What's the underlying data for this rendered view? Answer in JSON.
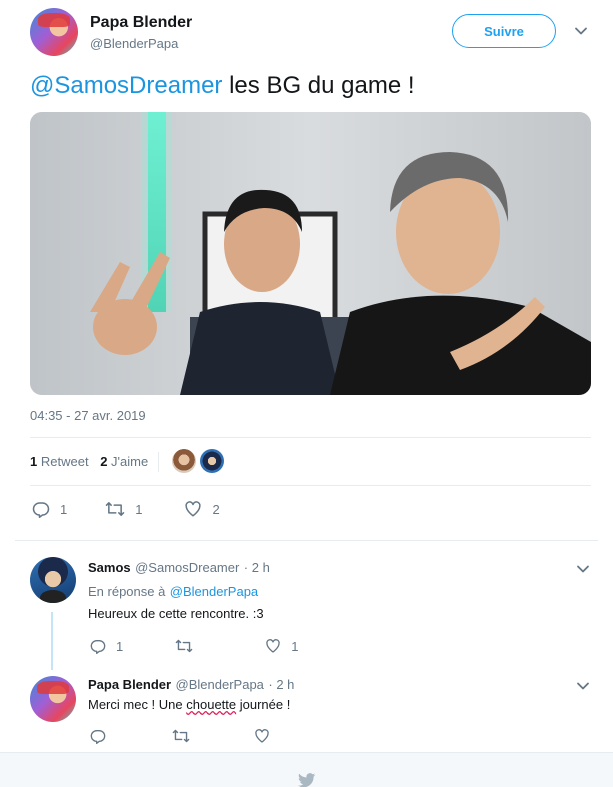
{
  "tweet": {
    "author": {
      "name": "Papa Blender",
      "handle": "@BlenderPapa"
    },
    "follow_label": "Suivre",
    "text_mention": "@SamosDreamer",
    "text_rest": " les BG du game !",
    "timestamp": "04:35 - 27 avr. 2019",
    "stats": {
      "retweets_count": "1",
      "retweets_label": "Retweet",
      "likes_count": "2",
      "likes_label": "J'aime"
    },
    "actions": {
      "replies": "1",
      "retweets": "1",
      "likes": "2"
    }
  },
  "replies": [
    {
      "name": "Samos",
      "handle": "@SamosDreamer",
      "time": "· 2 h",
      "reply_to_prefix": "En réponse à",
      "reply_to_handle": "@BlenderPapa",
      "text": "Heureux de cette rencontre. :3",
      "actions": {
        "replies": "1",
        "retweets": "",
        "likes": "1"
      }
    },
    {
      "name": "Papa Blender",
      "handle": "@BlenderPapa",
      "time": "· 2 h",
      "text_before": "Merci mec ! Une ",
      "text_misspelled": "chouette",
      "text_after": " journée !",
      "actions": {
        "replies": "",
        "retweets": "",
        "likes": ""
      }
    }
  ],
  "colors": {
    "accent": "#1da1f2",
    "mention": "#1b95e0",
    "muted": "#657786",
    "text": "#14171a"
  },
  "icons": [
    "chevron-down-icon",
    "reply-icon",
    "retweet-icon",
    "heart-icon",
    "twitter-bird-icon"
  ]
}
